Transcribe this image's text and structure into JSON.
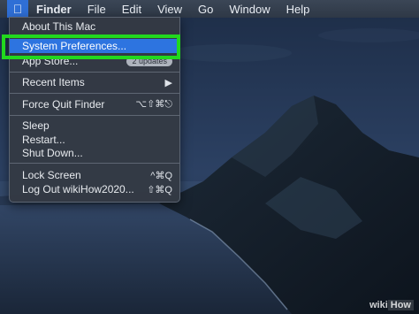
{
  "menubar": {
    "apple_icon": "apple-logo-icon",
    "items": [
      {
        "label": "Finder",
        "bold": true
      },
      {
        "label": "File"
      },
      {
        "label": "Edit"
      },
      {
        "label": "View"
      },
      {
        "label": "Go"
      },
      {
        "label": "Window"
      },
      {
        "label": "Help"
      }
    ]
  },
  "apple_menu": {
    "about": "About This Mac",
    "system_preferences": "System Preferences...",
    "app_store": "App Store...",
    "app_store_badge": "2 updates",
    "recent_items": "Recent Items",
    "recent_items_arrow": "▶",
    "force_quit": "Force Quit Finder",
    "force_quit_shortcut": "⌥⇧⌘⎋",
    "sleep": "Sleep",
    "restart": "Restart...",
    "shut_down": "Shut Down...",
    "lock_screen": "Lock Screen",
    "lock_screen_shortcut": "^⌘Q",
    "log_out": "Log Out wikiHow2020...",
    "log_out_shortcut": "⇧⌘Q"
  },
  "highlight_color": "#2d74e0",
  "callout_color": "#22d81e",
  "watermark": {
    "prefix": "wiki",
    "suffix": "How"
  }
}
